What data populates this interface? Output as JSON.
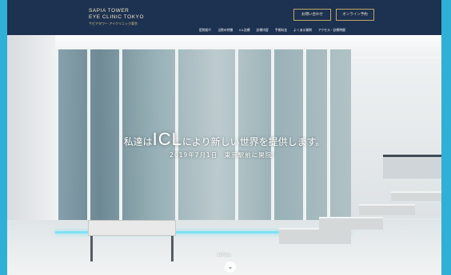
{
  "header": {
    "logo_en_line1": "SAPIA TOWER",
    "logo_en_line2": "EYE CLINIC TOKYO",
    "logo_ja": "サピアタワー アイクリニック東京",
    "contact_button": "お問い合わせ",
    "reserve_button": "オンライン予約"
  },
  "nav": {
    "items": [
      "医院紹介",
      "当院の特徴",
      "ICL治療",
      "診療内容",
      "手術料金",
      "よくある質問",
      "アクセス・診療時間"
    ]
  },
  "hero": {
    "catch_pre": "私達は",
    "catch_icl": "ICL",
    "catch_post": "により新しい世界を提供します。",
    "subcopy": "2019年7月1日　東京駅前に開院！",
    "scroll_label": "SCROLL",
    "scroll_icon": "chevron-down-icon"
  },
  "colors": {
    "header_bg": "#1d3150",
    "gold_border": "#bda86a",
    "outer_bg": "#2fb0d6"
  }
}
